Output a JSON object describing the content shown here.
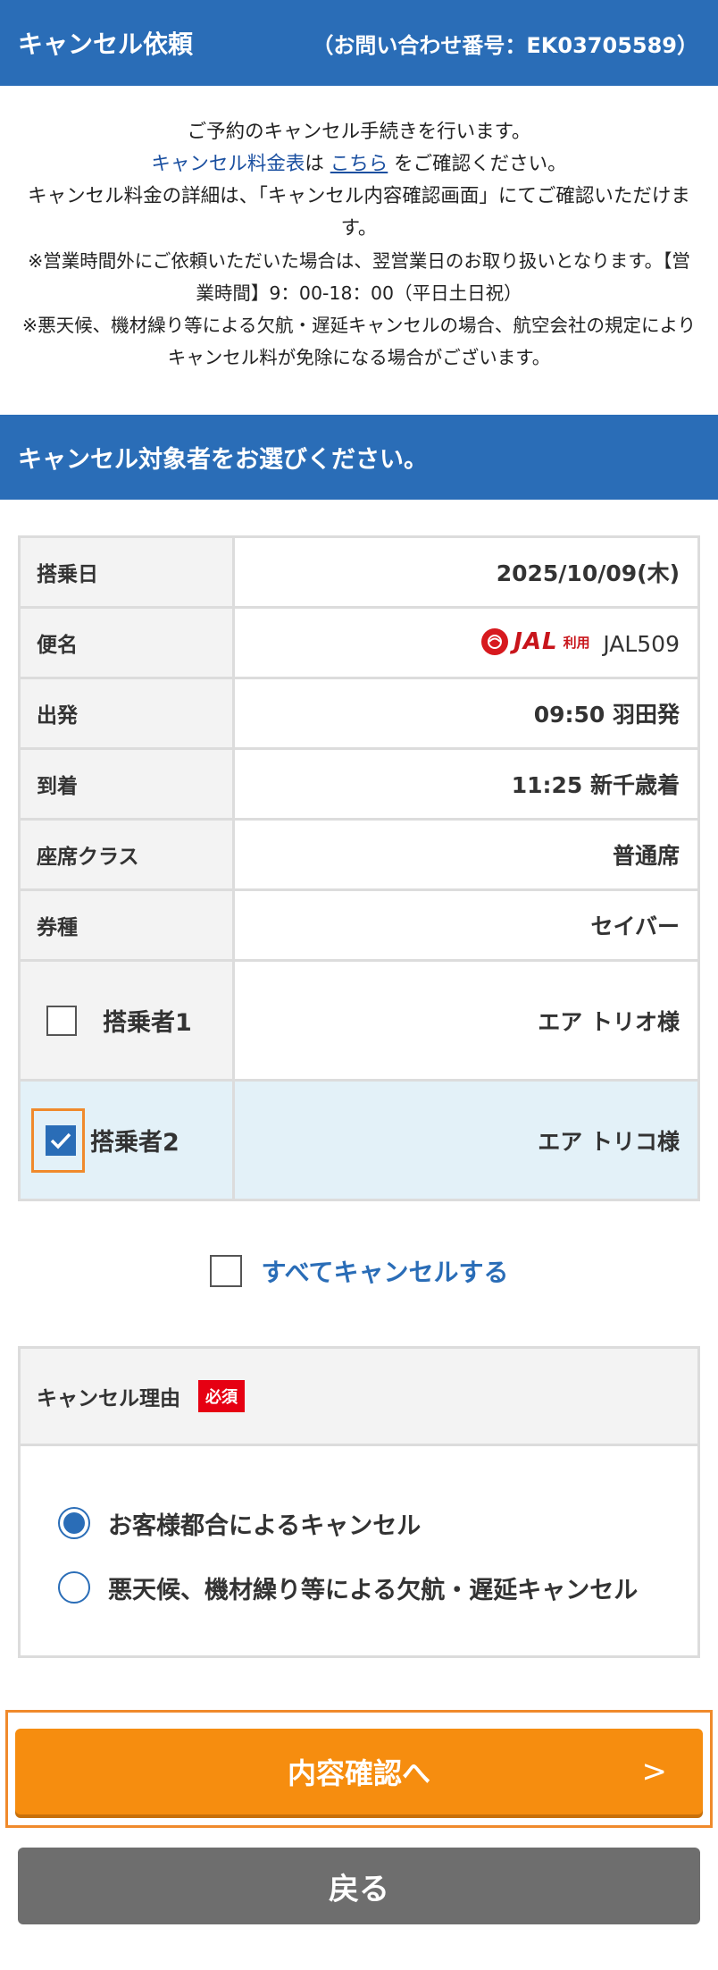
{
  "header": {
    "title": "キャンセル依頼",
    "inquiry": "（お問い合わせ番号：EK03705589）"
  },
  "notice": {
    "line1": "ご予約のキャンセル手続きを行います。",
    "line2_prefix": "キャンセル料金表",
    "line2_mid": "は ",
    "line2_link": "こちら",
    "line2_suffix": " をご確認ください。",
    "line3": "キャンセル料金の詳細は、「キャンセル内容確認画面」にてご確認いただけます。",
    "line4": "※営業時間外にご依頼いただいた場合は、翌営業日のお取り扱いとなります。【営業時間】9：00-18：00（平日土日祝）",
    "line5": "※悪天候、機材繰り等による欠航・遅延キャンセルの場合、航空会社の規定によりキャンセル料が免除になる場合がございます。"
  },
  "section": {
    "title": "キャンセル対象者をお選びください。"
  },
  "flight": {
    "date_label": "搭乗日",
    "date_value": "2025/10/09(木)",
    "flight_label": "便名",
    "airline_logo_text": "JAL",
    "airline_use": "利用",
    "flight_value": "JAL509",
    "depart_label": "出発",
    "depart_value": "09:50 羽田発",
    "arrive_label": "到着",
    "arrive_value": "11:25 新千歳着",
    "seat_label": "座席クラス",
    "seat_value": "普通席",
    "fare_label": "券種",
    "fare_value": "セイバー"
  },
  "passengers": [
    {
      "label": "搭乗者1",
      "name": "エア トリオ様",
      "checked": false
    },
    {
      "label": "搭乗者2",
      "name": "エア トリコ様",
      "checked": true
    }
  ],
  "all_cancel": {
    "label": "すべてキャンセルする",
    "checked": false
  },
  "reason": {
    "title": "キャンセル理由",
    "required": "必須",
    "options": [
      {
        "label": "お客様都合によるキャンセル",
        "selected": true
      },
      {
        "label": "悪天候、機材繰り等による欠航・遅延キャンセル",
        "selected": false
      }
    ]
  },
  "buttons": {
    "confirm": "内容確認へ",
    "confirm_arrow": ">",
    "back": "戻る"
  },
  "colors": {
    "primary": "#2a6db7",
    "accent": "#f68d0f",
    "highlight": "#f08a2c",
    "required": "#e60012"
  }
}
